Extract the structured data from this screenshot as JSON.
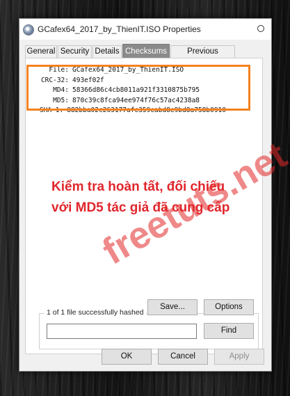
{
  "window": {
    "title": "GCafex64_2017_by_ThienIT.ISO Properties"
  },
  "tabs": [
    {
      "label": "General"
    },
    {
      "label": "Security"
    },
    {
      "label": "Details"
    },
    {
      "label": "Checksums",
      "active": true
    },
    {
      "label": "Previous Versions"
    }
  ],
  "hashes": [
    {
      "key": "File:",
      "value": "GCafex64_2017_by_ThienIT.ISO"
    },
    {
      "key": "CRC-32:",
      "value": "493ef02f"
    },
    {
      "key": "MD4:",
      "value": "58366d86c4cb8011a921f3310875b795"
    },
    {
      "key": "MD5:",
      "value": "870c39c8fca94ee974f76c57ac4238a8"
    },
    {
      "key": "SHA-1:",
      "value": "882bba02c263177afe359eabd8e9bd8a758b0910"
    }
  ],
  "annotation": {
    "line1": "Kiểm tra hoàn tất, đối chiếu",
    "line2": "với MD5 tác giả đã cung cấp",
    "color": "#e0262c",
    "highlight_color": "#f58220"
  },
  "watermark": {
    "text": "freetuts.net"
  },
  "status": {
    "message": "1 of 1 file successfully hashed",
    "input_value": ""
  },
  "buttons": {
    "find": "Find",
    "save": "Save...",
    "options": "Options",
    "ok": "OK",
    "cancel": "Cancel",
    "apply": "Apply"
  }
}
